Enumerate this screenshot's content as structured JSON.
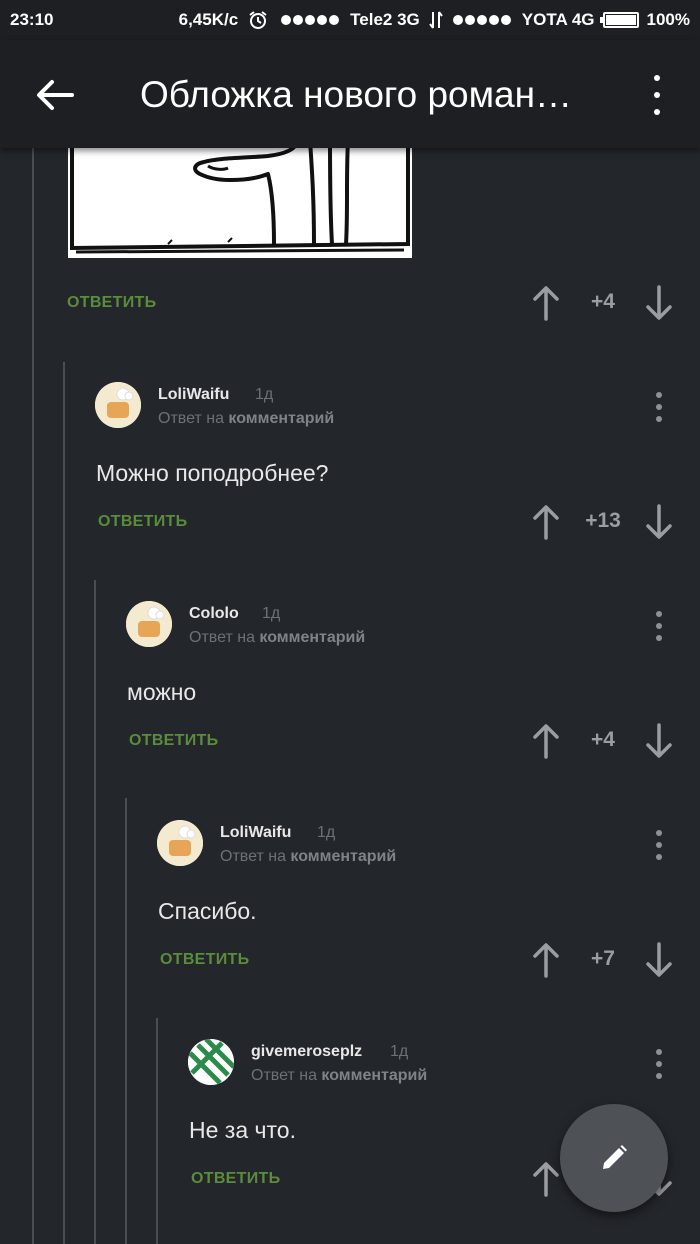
{
  "status_bar": {
    "time": "23:10",
    "speed": "6,45K/c",
    "carrier1": "Tele2 3G",
    "carrier2": "YOTA 4G",
    "battery": "100%"
  },
  "app_bar": {
    "title": "Обложка нового роман…",
    "back_icon": "arrow-left-icon",
    "menu_icon": "more-vert-icon"
  },
  "colors": {
    "background": "#23262b",
    "bar": "#1d1f22",
    "reply_green": "#5a8c3c",
    "muted": "#6d7177"
  },
  "top_comment": {
    "reply_label": "ОТВЕТИТЬ",
    "rating": "+4"
  },
  "comments": [
    {
      "author": "LoliWaifu",
      "time": "1д",
      "reply_to_prefix": "Ответ на",
      "reply_to_link": "комментарий",
      "text": "Можно поподробнее?",
      "reply_label": "ОТВЕТИТЬ",
      "rating": "+13"
    },
    {
      "author": "Cololo",
      "time": "1д",
      "reply_to_prefix": "Ответ на",
      "reply_to_link": "комментарий",
      "text": "можно",
      "reply_label": "ОТВЕТИТЬ",
      "rating": "+4"
    },
    {
      "author": "LoliWaifu",
      "time": "1д",
      "reply_to_prefix": "Ответ на",
      "reply_to_link": "комментарий",
      "text": "Спасибо.",
      "reply_label": "ОТВЕТИТЬ",
      "rating": "+7"
    },
    {
      "author": "givemeroseplz",
      "time": "1д",
      "reply_to_prefix": "Ответ на",
      "reply_to_link": "комментарий",
      "text": "Не за что.",
      "reply_label": "ОТВЕТИТЬ"
    }
  ],
  "fab": {
    "icon": "pencil-icon"
  }
}
